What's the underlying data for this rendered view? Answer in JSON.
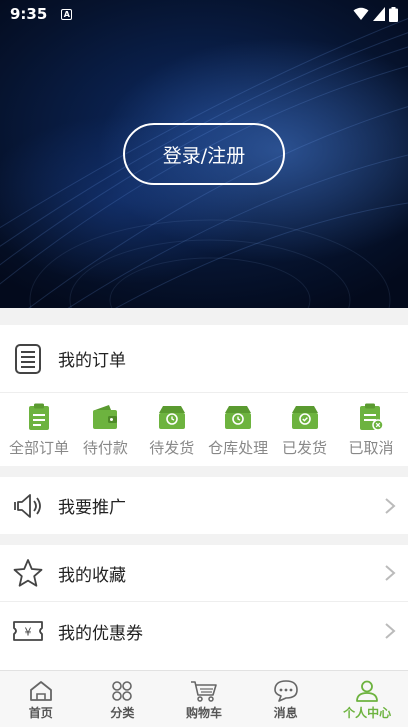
{
  "status": {
    "time": "9:35",
    "badge": "A"
  },
  "hero": {
    "login_label": "登录/注册"
  },
  "orders": {
    "title": "我的订单",
    "items": [
      {
        "label": "全部订单",
        "icon": "clipboard-icon"
      },
      {
        "label": "待付款",
        "icon": "wallet-icon"
      },
      {
        "label": "待发货",
        "icon": "box-clock-icon"
      },
      {
        "label": "仓库处理",
        "icon": "box-clock-icon"
      },
      {
        "label": "已发货",
        "icon": "box-check-icon"
      },
      {
        "label": "已取消",
        "icon": "clipboard-cancel-icon"
      }
    ]
  },
  "menu": {
    "promote": "我要推广",
    "favorites": "我的收藏",
    "coupons": "我的优惠券",
    "coupon_symbol": "¥"
  },
  "tabbar": {
    "items": [
      {
        "label": "首页",
        "icon": "home-icon"
      },
      {
        "label": "分类",
        "icon": "category-icon"
      },
      {
        "label": "购物车",
        "icon": "cart-icon"
      },
      {
        "label": "消息",
        "icon": "message-icon"
      },
      {
        "label": "个人中心",
        "icon": "person-icon"
      }
    ],
    "active_index": 4
  },
  "colors": {
    "accent": "#6db33f",
    "hero_bg": "#06132e",
    "text": "#222222",
    "muted": "#888888"
  }
}
